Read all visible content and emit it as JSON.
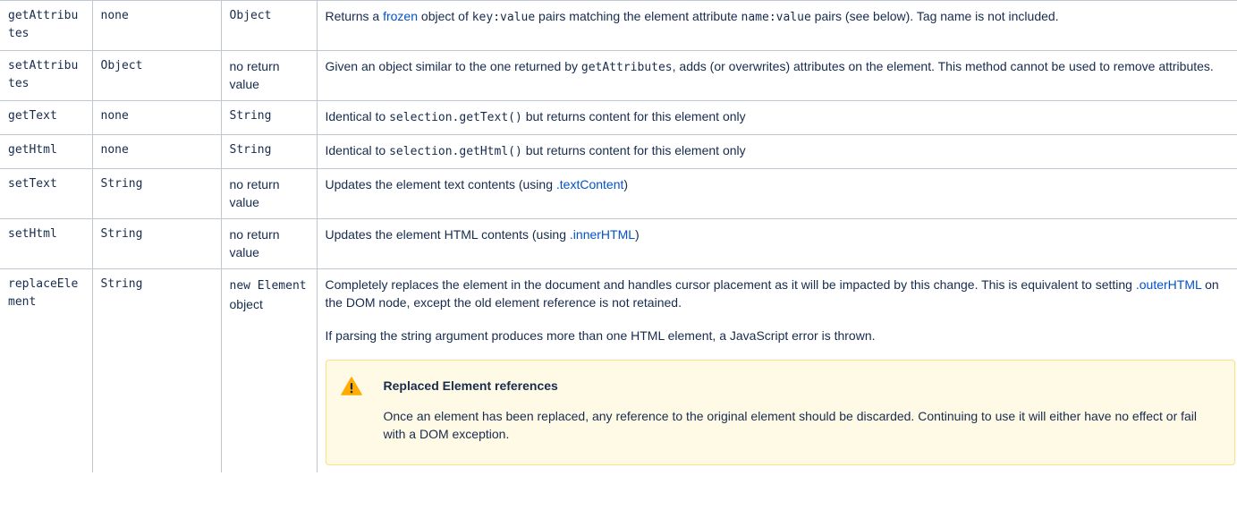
{
  "rows": [
    {
      "method": "getAttributes",
      "params": "none",
      "returns": "Object",
      "desc": {
        "t1": "Returns a ",
        "link": "frozen",
        "t2": " object of ",
        "code1": "key:value",
        "t3": " pairs matching the element attribute ",
        "code2": "name:value",
        "t4": " pairs (see below). Tag name is not included."
      }
    },
    {
      "method": "setAttributes",
      "params": "Object",
      "returns": "no return value",
      "desc": {
        "t1": "Given an object similar to the one returned by ",
        "code1": "getAttributes",
        "t2": ", adds (or overwrites) attributes on the element. This method cannot be used to remove attributes."
      }
    },
    {
      "method": "getText",
      "params": "none",
      "returns": "String",
      "desc": {
        "t1": "Identical to ",
        "code1": "selection.getText()",
        "t2": " but returns content for this element only"
      }
    },
    {
      "method": "getHtml",
      "params": "none",
      "returns": "String",
      "desc": {
        "t1": "Identical to ",
        "code1": "selection.getHtml()",
        "t2": " but returns content for this element only"
      }
    },
    {
      "method": "setText",
      "params": "String",
      "returns": "no return value",
      "desc": {
        "t1": "Updates the element text contents (using ",
        "link": ".textContent",
        "t2": ")"
      }
    },
    {
      "method": "setHtml",
      "params": "String",
      "returns": "no return value",
      "desc": {
        "t1": "Updates the element HTML contents (using ",
        "link": ".innerHTML",
        "t2": ")"
      }
    },
    {
      "method": "replaceElement",
      "params": "String",
      "returns_code": "new Element",
      "returns_text": " object",
      "desc": {
        "t1": "Completely replaces the element in the document and handles cursor placement as it will be impacted by this change. This is equivalent to setting ",
        "link": ".outerHTML",
        "t2": " on the DOM node, except the old element reference is not retained.",
        "p2": "If parsing the string argument produces more than one HTML element, a JavaScript error is thrown."
      },
      "panel": {
        "icon": "warning-icon",
        "title": "Replaced Element references",
        "text": "Once an element has been replaced, any reference to the original element should be discarded. Continuing to use it will either have no effect or fail with a DOM exception."
      }
    }
  ],
  "colors": {
    "text": "#172b4d",
    "link": "#0052cc",
    "border": "#c1c7d0",
    "panel_bg": "#fffae6",
    "panel_border": "#ffe380",
    "warning_icon": "#ffab00"
  }
}
